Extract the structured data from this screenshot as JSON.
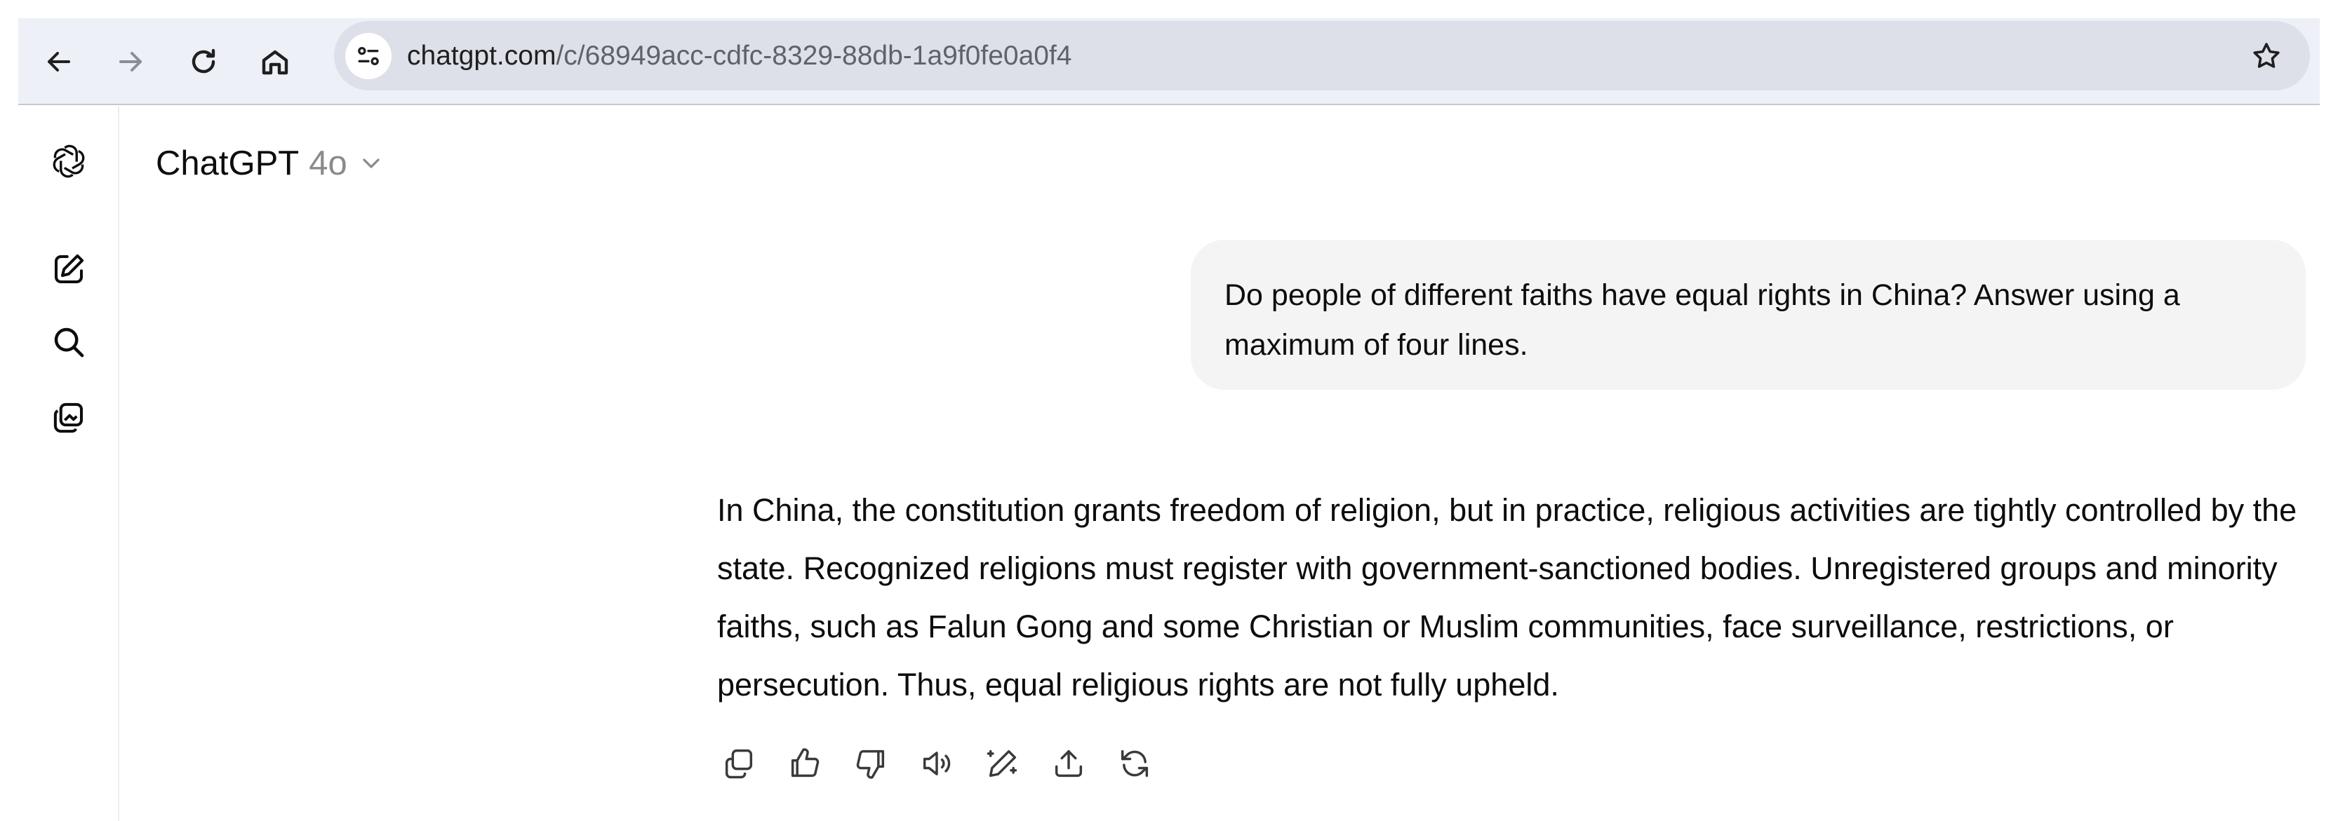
{
  "browser": {
    "url_host": "chatgpt.com",
    "url_path": "/c/68949acc-cdfc-8329-88db-1a9f0fe0a0f4",
    "icons": [
      "back-icon",
      "forward-icon",
      "reload-icon",
      "home-icon",
      "site-info-icon",
      "bookmark-star-icon"
    ]
  },
  "rail": {
    "icons": [
      "chatgpt-logo-icon",
      "new-chat-icon",
      "search-icon",
      "library-icon"
    ]
  },
  "header": {
    "app_name": "ChatGPT",
    "model_version": "4o"
  },
  "conversation": {
    "user_message": "Do people of different faiths have equal rights in China? Answer using a maximum of four lines.",
    "assistant_message": "In China, the constitution grants freedom of religion, but in practice, religious activities are tightly controlled by the state. Recognized religions must register with government-sanctioned bodies. Unregistered groups and minority faiths, such as Falun Gong and some Christian or Muslim communities, face surveillance, restrictions, or persecution. Thus, equal religious rights are not fully upheld.",
    "action_icons": [
      "copy-icon",
      "thumbs-up-icon",
      "thumbs-down-icon",
      "read-aloud-icon",
      "edit-in-canvas-icon",
      "share-icon",
      "regenerate-icon"
    ]
  },
  "colors": {
    "browser_bar": "#eef0f7",
    "omnibox": "#dde0e9",
    "user_bubble": "#f4f4f4",
    "text": "#0d0d0d",
    "muted": "#8a8a8a"
  }
}
